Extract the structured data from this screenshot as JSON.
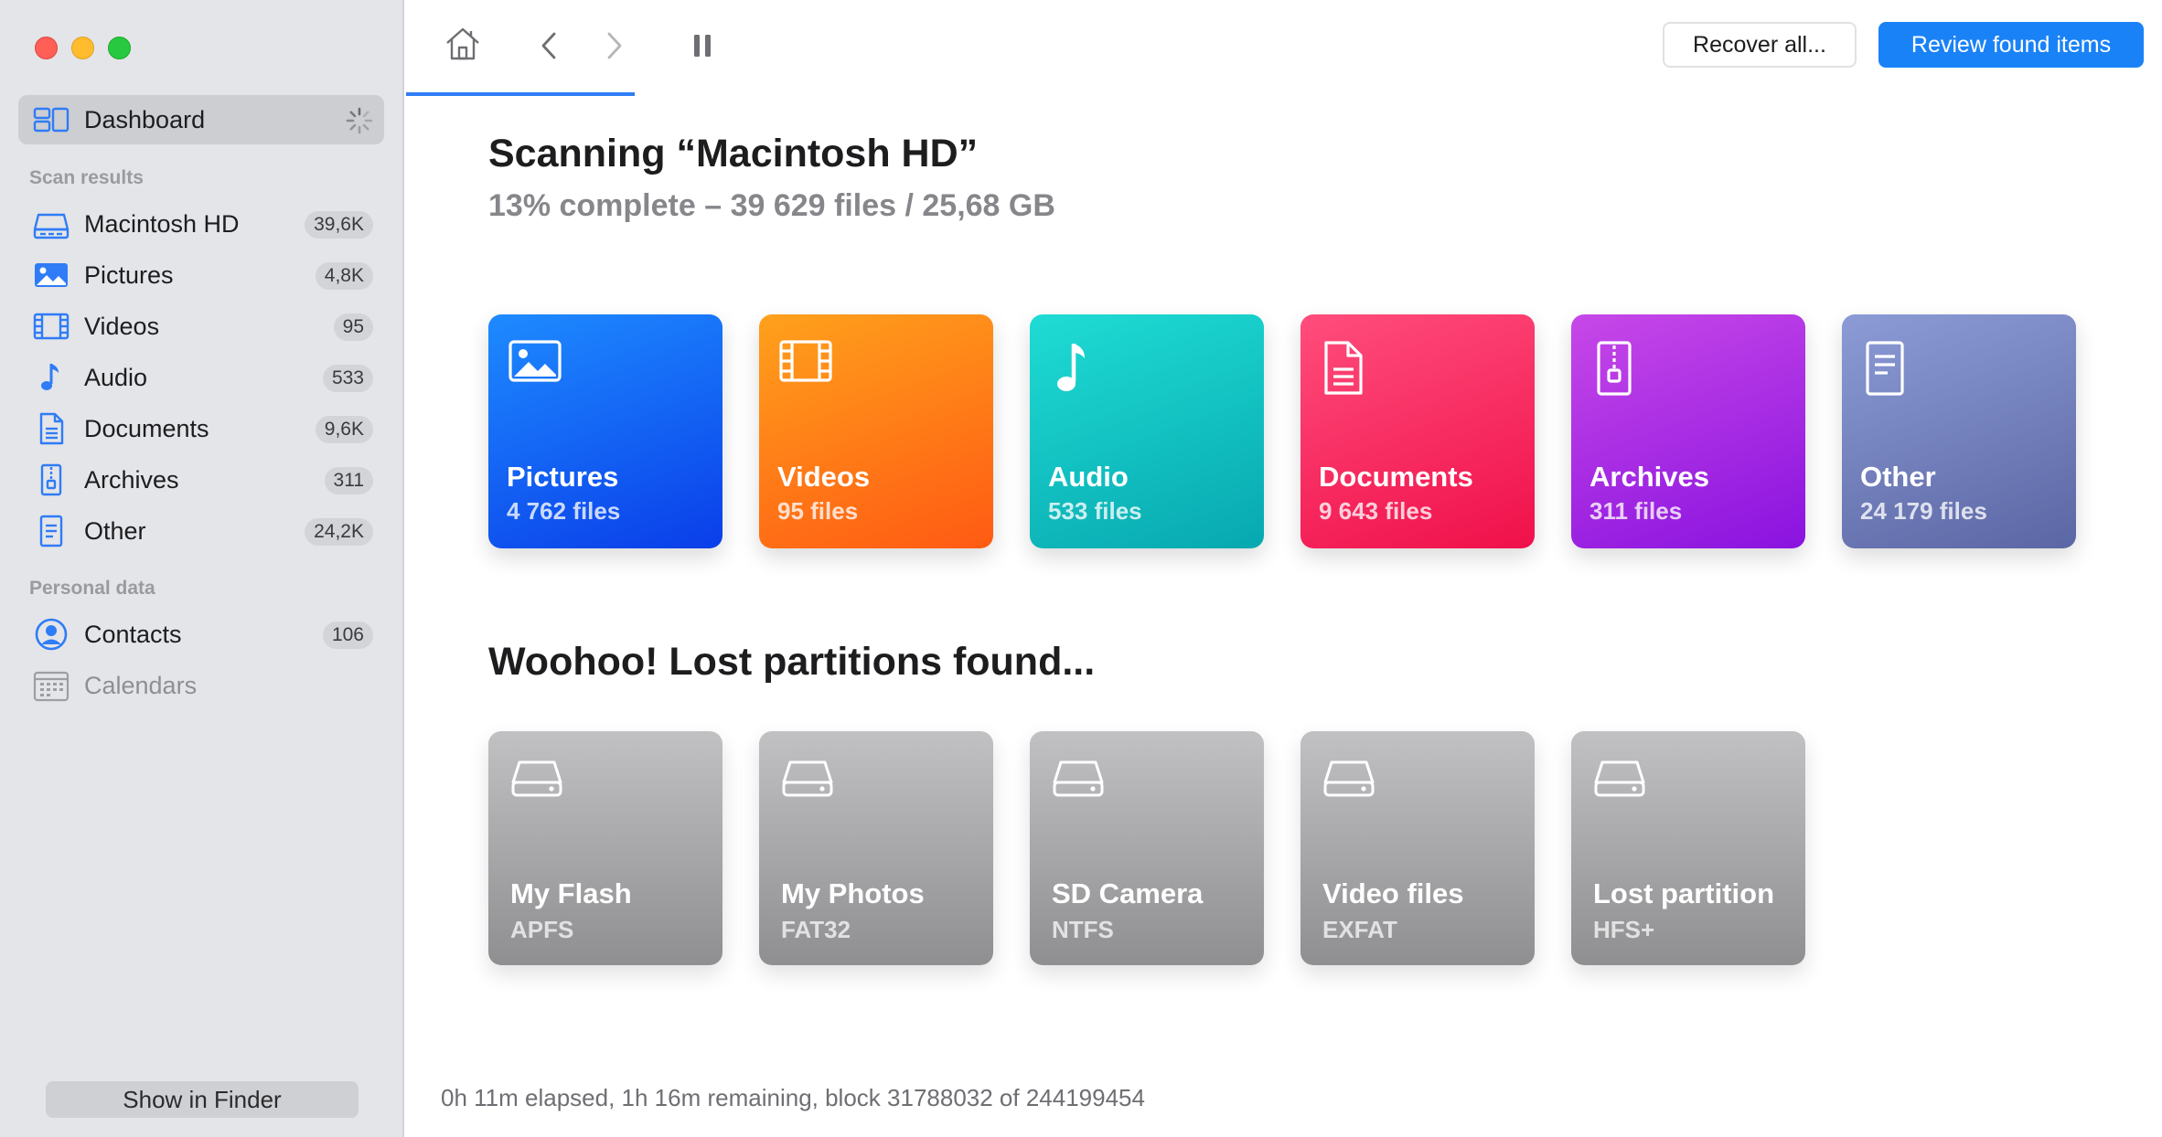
{
  "window": {
    "controls": [
      "close",
      "minimize",
      "zoom"
    ]
  },
  "sidebar": {
    "dashboard": {
      "label": "Dashboard",
      "icon": "dashboard-icon",
      "status_icon": "spinner-icon"
    },
    "scan_results": {
      "heading": "Scan results",
      "items": [
        {
          "label": "Macintosh HD",
          "count": "39,6K",
          "icon": "drive-icon"
        },
        {
          "label": "Pictures",
          "count": "4,8K",
          "icon": "picture-icon"
        },
        {
          "label": "Videos",
          "count": "95",
          "icon": "film-icon"
        },
        {
          "label": "Audio",
          "count": "533",
          "icon": "music-note-icon"
        },
        {
          "label": "Documents",
          "count": "9,6K",
          "icon": "document-icon"
        },
        {
          "label": "Archives",
          "count": "311",
          "icon": "archive-icon"
        },
        {
          "label": "Other",
          "count": "24,2K",
          "icon": "file-icon"
        }
      ]
    },
    "personal_data": {
      "heading": "Personal data",
      "items": [
        {
          "label": "Contacts",
          "count": "106",
          "icon": "contact-icon"
        },
        {
          "label": "Calendars",
          "count": "",
          "icon": "calendar-icon"
        }
      ]
    },
    "show_in_finder": "Show in Finder"
  },
  "toolbar": {
    "icons": [
      "home-icon",
      "back-icon",
      "forward-icon",
      "pause-icon"
    ],
    "recover_all": "Recover all...",
    "review_found": "Review found items",
    "accent": "#1a82f7"
  },
  "main": {
    "title": "Scanning “Macintosh HD”",
    "progress": "13% complete – 39 629 files / 25,68 GB",
    "categories": [
      {
        "name": "Pictures",
        "count": "4 762 files",
        "icon": "picture-icon"
      },
      {
        "name": "Videos",
        "count": "95 files",
        "icon": "film-icon"
      },
      {
        "name": "Audio",
        "count": "533 files",
        "icon": "music-note-icon"
      },
      {
        "name": "Documents",
        "count": "9 643 files",
        "icon": "document-icon"
      },
      {
        "name": "Archives",
        "count": "311 files",
        "icon": "archive-icon"
      },
      {
        "name": "Other",
        "count": "24 179 files",
        "icon": "file-icon"
      }
    ],
    "partitions_title": "Woohoo! Lost partitions found...",
    "partitions": [
      {
        "name": "My Flash",
        "fs": "APFS",
        "icon": "drive-icon"
      },
      {
        "name": "My Photos",
        "fs": "FAT32",
        "icon": "drive-icon"
      },
      {
        "name": "SD Camera",
        "fs": "NTFS",
        "icon": "drive-icon"
      },
      {
        "name": "Video files",
        "fs": "EXFAT",
        "icon": "drive-icon"
      },
      {
        "name": "Lost partition",
        "fs": "HFS+",
        "icon": "drive-icon"
      }
    ],
    "status": "0h 11m elapsed, 1h 16m remaining, block 31788032 of 244199454"
  }
}
